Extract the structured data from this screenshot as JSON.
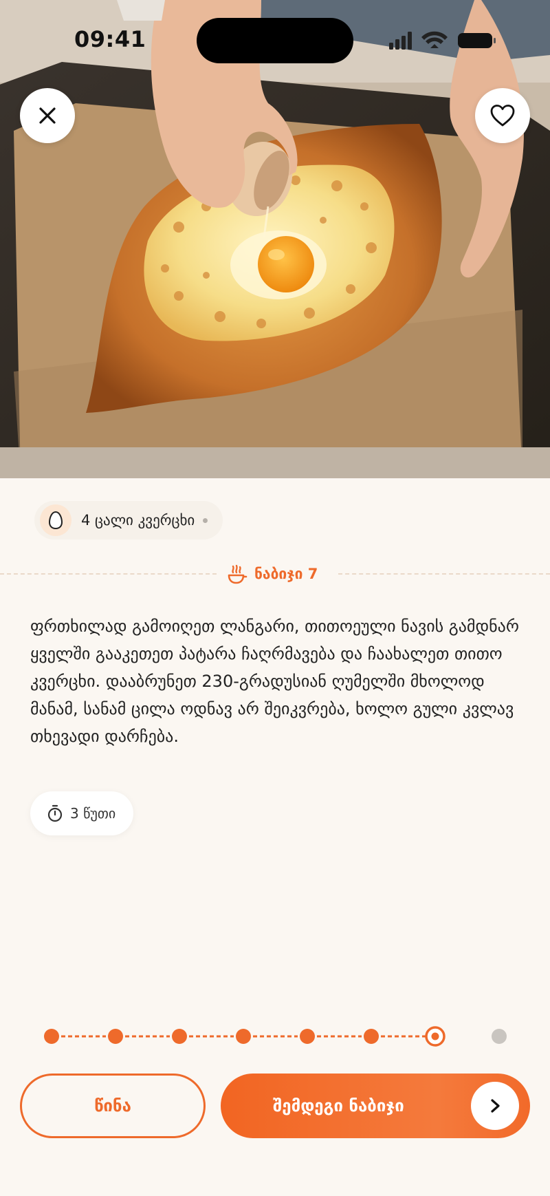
{
  "status_bar": {
    "time": "09:41",
    "icons": [
      "signal-icon",
      "wifi-icon",
      "battery-icon"
    ]
  },
  "hero": {
    "alt_hint": "photo-acharuli-khachapuri-egg",
    "buttons": [
      "close-icon",
      "heart-icon"
    ]
  },
  "ingredient": {
    "icon": "egg-icon",
    "label": "4 ცალი კვერცხი"
  },
  "step": {
    "icon": "steam-icon",
    "label": "ნაბიჯი 7",
    "text": "ფრთხილად გამოიღეთ ლანგარი, თითოეული ნავის გამდნარ ყველში გააკეთეთ პატარა ჩაღრმავება და ჩაახალეთ თითო კვერცხი. დააბრუნეთ 230-გრადუსიან ღუმელში მხოლოდ მანამ, სანამ ცილა ოდნავ არ შეიკვრება, ხოლო გული კვლავ თხევადი დარჩება.",
    "timer_icon": "timer-icon",
    "timer": "3 წუთი"
  },
  "progress": {
    "total_steps": 8,
    "current_step": 7,
    "colors": {
      "done": "#EE6A2B",
      "current": "#EE6A2B",
      "upcoming": "#C9C5C0"
    }
  },
  "nav": {
    "prev_label": "წინა",
    "next_label": "შემდეგი ნაბიჯი",
    "next_icon": "chevron-right-icon"
  },
  "colors": {
    "accent": "#EE6A2B",
    "background": "#FBF7F2",
    "chip_bg": "#F6F1EA"
  }
}
